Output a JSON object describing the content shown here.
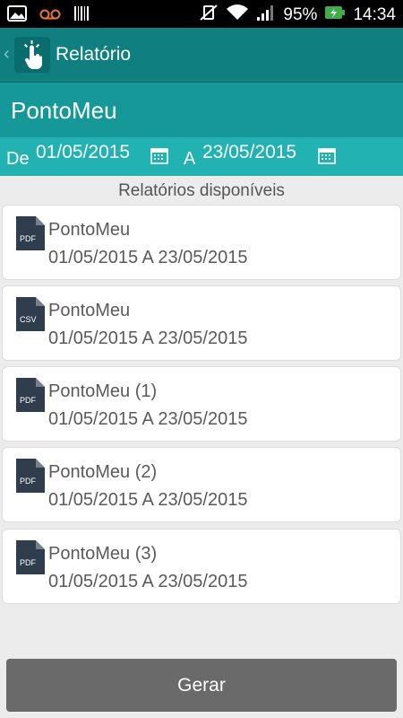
{
  "status_bar": {
    "battery": "95%",
    "time": "14:34"
  },
  "action_bar": {
    "title": "Relatório"
  },
  "header": {
    "title": "PontoMeu"
  },
  "date_range": {
    "from_label": "De",
    "from_value": "01/05/2015",
    "to_label": "A",
    "to_value": "23/05/2015"
  },
  "section_title": "Relatórios disponíveis",
  "reports": [
    {
      "type": "PDF",
      "name": "PontoMeu",
      "range": "01/05/2015 A 23/05/2015"
    },
    {
      "type": "CSV",
      "name": "PontoMeu",
      "range": "01/05/2015 A 23/05/2015"
    },
    {
      "type": "PDF",
      "name": "PontoMeu (1)",
      "range": "01/05/2015 A 23/05/2015"
    },
    {
      "type": "PDF",
      "name": "PontoMeu (2)",
      "range": "01/05/2015 A 23/05/2015"
    },
    {
      "type": "PDF",
      "name": "PontoMeu (3)",
      "range": "01/05/2015 A 23/05/2015"
    }
  ],
  "generate_button": "Gerar",
  "colors": {
    "action_bar": "#0f7f7f",
    "header": "#169898",
    "date_bar": "#22b2b2",
    "button": "#6a6a6a",
    "file_icon": "#2f3d4c"
  }
}
